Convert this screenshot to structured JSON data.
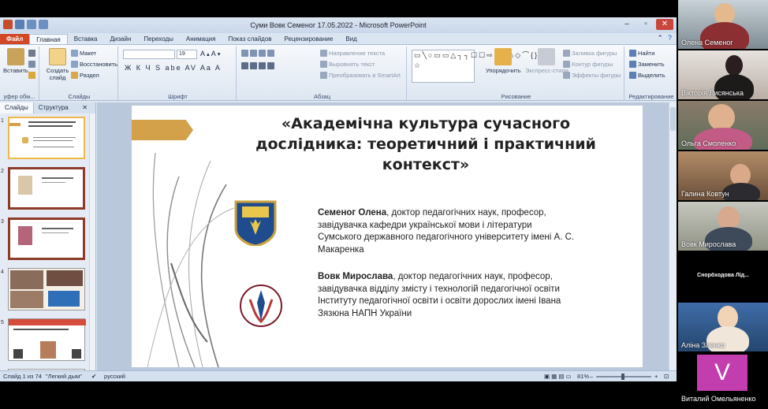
{
  "window": {
    "title": "Суми Вовк Семеног 17.05.2022 - Microsoft PowerPoint",
    "controls": [
      "–",
      "▫",
      "✕"
    ]
  },
  "ribbon_tabs": [
    "Файл",
    "Главная",
    "Вставка",
    "Дизайн",
    "Переходы",
    "Анимация",
    "Показ слайдов",
    "Рецензирование",
    "Вид"
  ],
  "ribbon": {
    "clipboard": {
      "paste": "Вставить",
      "label": "уфер обм..."
    },
    "slides": {
      "new_slide": "Создать слайд",
      "layout": "Макет",
      "restore": "Восстановить",
      "section": "Раздел",
      "label": "Слайды"
    },
    "font": {
      "size": "19",
      "label": "Шрифт",
      "tools": "Ж К Ч S abe AV Aa A"
    },
    "paragraph": {
      "direction": "Направление текста",
      "align": "Выровнять текст",
      "smartart": "Преобразовать в SmartArt",
      "label": "Абзац"
    },
    "drawing": {
      "arrange": "Упорядочить",
      "quick_styles": "Экспресс-стили",
      "fill": "Заливка фигуры",
      "outline": "Контур фигуры",
      "effects": "Эффекты фигуры",
      "label": "Рисование"
    },
    "editing": {
      "find": "Найти",
      "replace": "Заменить",
      "select": "Выделить",
      "label": "Редактирование"
    }
  },
  "left_panel": {
    "tabs": [
      "Слайды",
      "Структура"
    ],
    "close": "✕",
    "slide_numbers": [
      "1",
      "2",
      "3",
      "4",
      "5",
      "6"
    ]
  },
  "slide": {
    "title": "«Академічна культура сучасного дослідника: теоретичний і практичний контекст»",
    "author1": {
      "name": "Семеног Олена",
      "text": ", доктор педагогічних наук, професор, завідувачка кафедри української мови і літератури Сумського державного педагогічного університету імені А. С. Макаренка"
    },
    "author2": {
      "name": "Вовк Мирослава",
      "text": ", доктор педагогічних наук, професор, завідувачка відділу змісту і технологій педагогічної освіти Інституту педагогічної освіти і освіти дорослих імені Івана Зязюна НАПН України"
    }
  },
  "statusbar": {
    "slide": "Слайд 1 из 74",
    "theme": "\"Легкий дым\"",
    "language": "русский",
    "zoom": "81%"
  },
  "participants": [
    {
      "name": "Олена Семеног"
    },
    {
      "name": "Вікторія Лисянська"
    },
    {
      "name": "Ольга Смоленко"
    },
    {
      "name": "Галина Ковтун"
    },
    {
      "name": "Вовк Мирослава"
    },
    {
      "name": "Снорӧходова  Лід..."
    },
    {
      "name": "Аліна Зленко"
    },
    {
      "name": "Виталий Омельяненко",
      "initial": "V"
    }
  ],
  "colors": {
    "file_tab": "#d24726",
    "banner": "#d3a14a",
    "avatar_v": "#c23dad"
  }
}
